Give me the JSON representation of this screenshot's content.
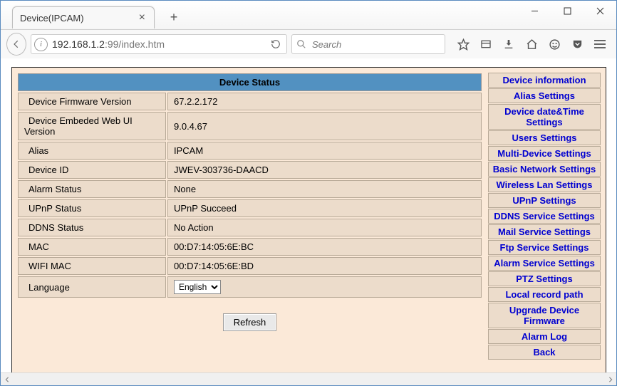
{
  "window": {
    "tab_title": "Device(IPCAM)"
  },
  "nav": {
    "url_prefix": "192.168.1.2",
    "url_suffix": ":99/index.htm",
    "search_placeholder": "Search"
  },
  "status": {
    "heading": "Device Status",
    "rows": {
      "firmware_label": "Device Firmware Version",
      "firmware_value": "67.2.2.172",
      "webui_label": "Device Embeded Web UI Version",
      "webui_value": "9.0.4.67",
      "alias_label": "Alias",
      "alias_value": "IPCAM",
      "deviceid_label": "Device ID",
      "deviceid_value": "JWEV-303736-DAACD",
      "alarm_label": "Alarm Status",
      "alarm_value": "None",
      "upnp_label": "UPnP Status",
      "upnp_value": "UPnP Succeed",
      "ddns_label": "DDNS Status",
      "ddns_value": "No Action",
      "mac_label": "MAC",
      "mac_value": "00:D7:14:05:6E:BC",
      "wifimac_label": "WIFI MAC",
      "wifimac_value": "00:D7:14:05:6E:BD",
      "language_label": "Language",
      "language_value": "English"
    },
    "refresh_label": "Refresh"
  },
  "menu": {
    "items": [
      "Device information",
      "Alias Settings",
      "Device date&Time Settings",
      "Users Settings",
      "Multi-Device Settings",
      "Basic Network Settings",
      "Wireless Lan Settings",
      "UPnP Settings",
      "DDNS Service Settings",
      "Mail Service Settings",
      "Ftp Service Settings",
      "Alarm Service Settings",
      "PTZ Settings",
      "Local record path",
      "Upgrade Device Firmware",
      "Alarm Log",
      "Back"
    ]
  }
}
